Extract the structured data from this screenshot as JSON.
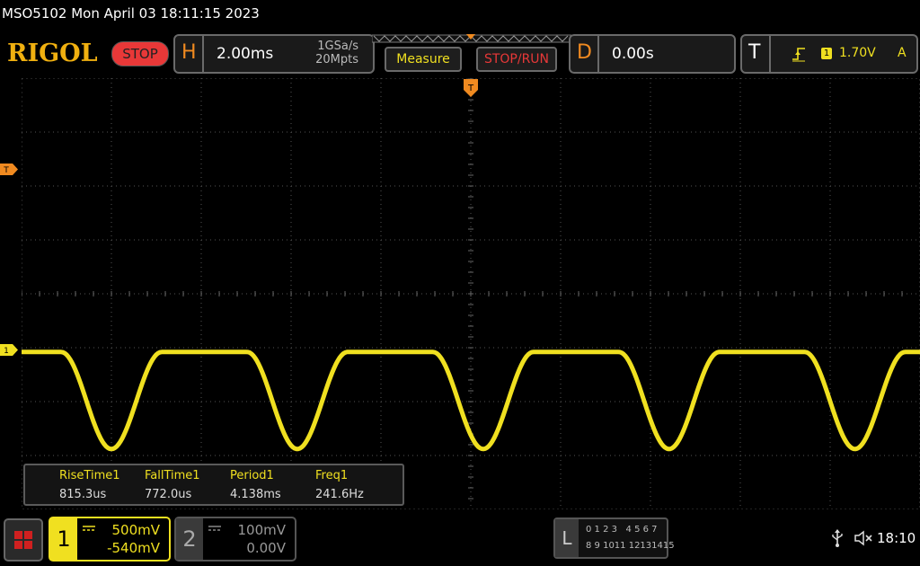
{
  "title_bar": {
    "text": "MSO5102  Mon April 03 18:11:15 2023"
  },
  "brand": {
    "name": "RIGOL",
    "status": "STOP"
  },
  "horizontal": {
    "letter": "H",
    "timebase": "2.00ms",
    "sample_rate": "1GSa/s",
    "memory_depth": "20Mpts"
  },
  "buttons": {
    "measure": "Measure",
    "stop_run": "STOP/RUN"
  },
  "delay": {
    "letter": "D",
    "value": "0.00s"
  },
  "trigger": {
    "letter": "T",
    "source_label": "1",
    "level": "1.70V",
    "coupling": "A",
    "marker_label": "T"
  },
  "channel_markers": {
    "ch1": "1"
  },
  "measurements": [
    {
      "label": "RiseTime1",
      "value": "815.3us"
    },
    {
      "label": "FallTime1",
      "value": "772.0us"
    },
    {
      "label": "Period1",
      "value": "4.138ms"
    },
    {
      "label": "Freq1",
      "value": "241.6Hz"
    }
  ],
  "ch1": {
    "number": "1",
    "scale": "500mV",
    "offset": "-540mV",
    "color": "#f0e020"
  },
  "ch2": {
    "number": "2",
    "scale": "100mV",
    "offset": "0.00V"
  },
  "logic_analyzer": {
    "letter": "L",
    "row1": "0 1 2 3   4 5 6 7",
    "row2": "8 9 1011 12131415"
  },
  "status": {
    "clock": "18:10"
  },
  "waveform": {
    "color": "#f0e020",
    "period_ms": 4.138,
    "ms_per_div": 2.0,
    "high_v": 0.0,
    "low_v": -0.9,
    "v_per_div": 0.5,
    "offset_v": -0.54
  }
}
